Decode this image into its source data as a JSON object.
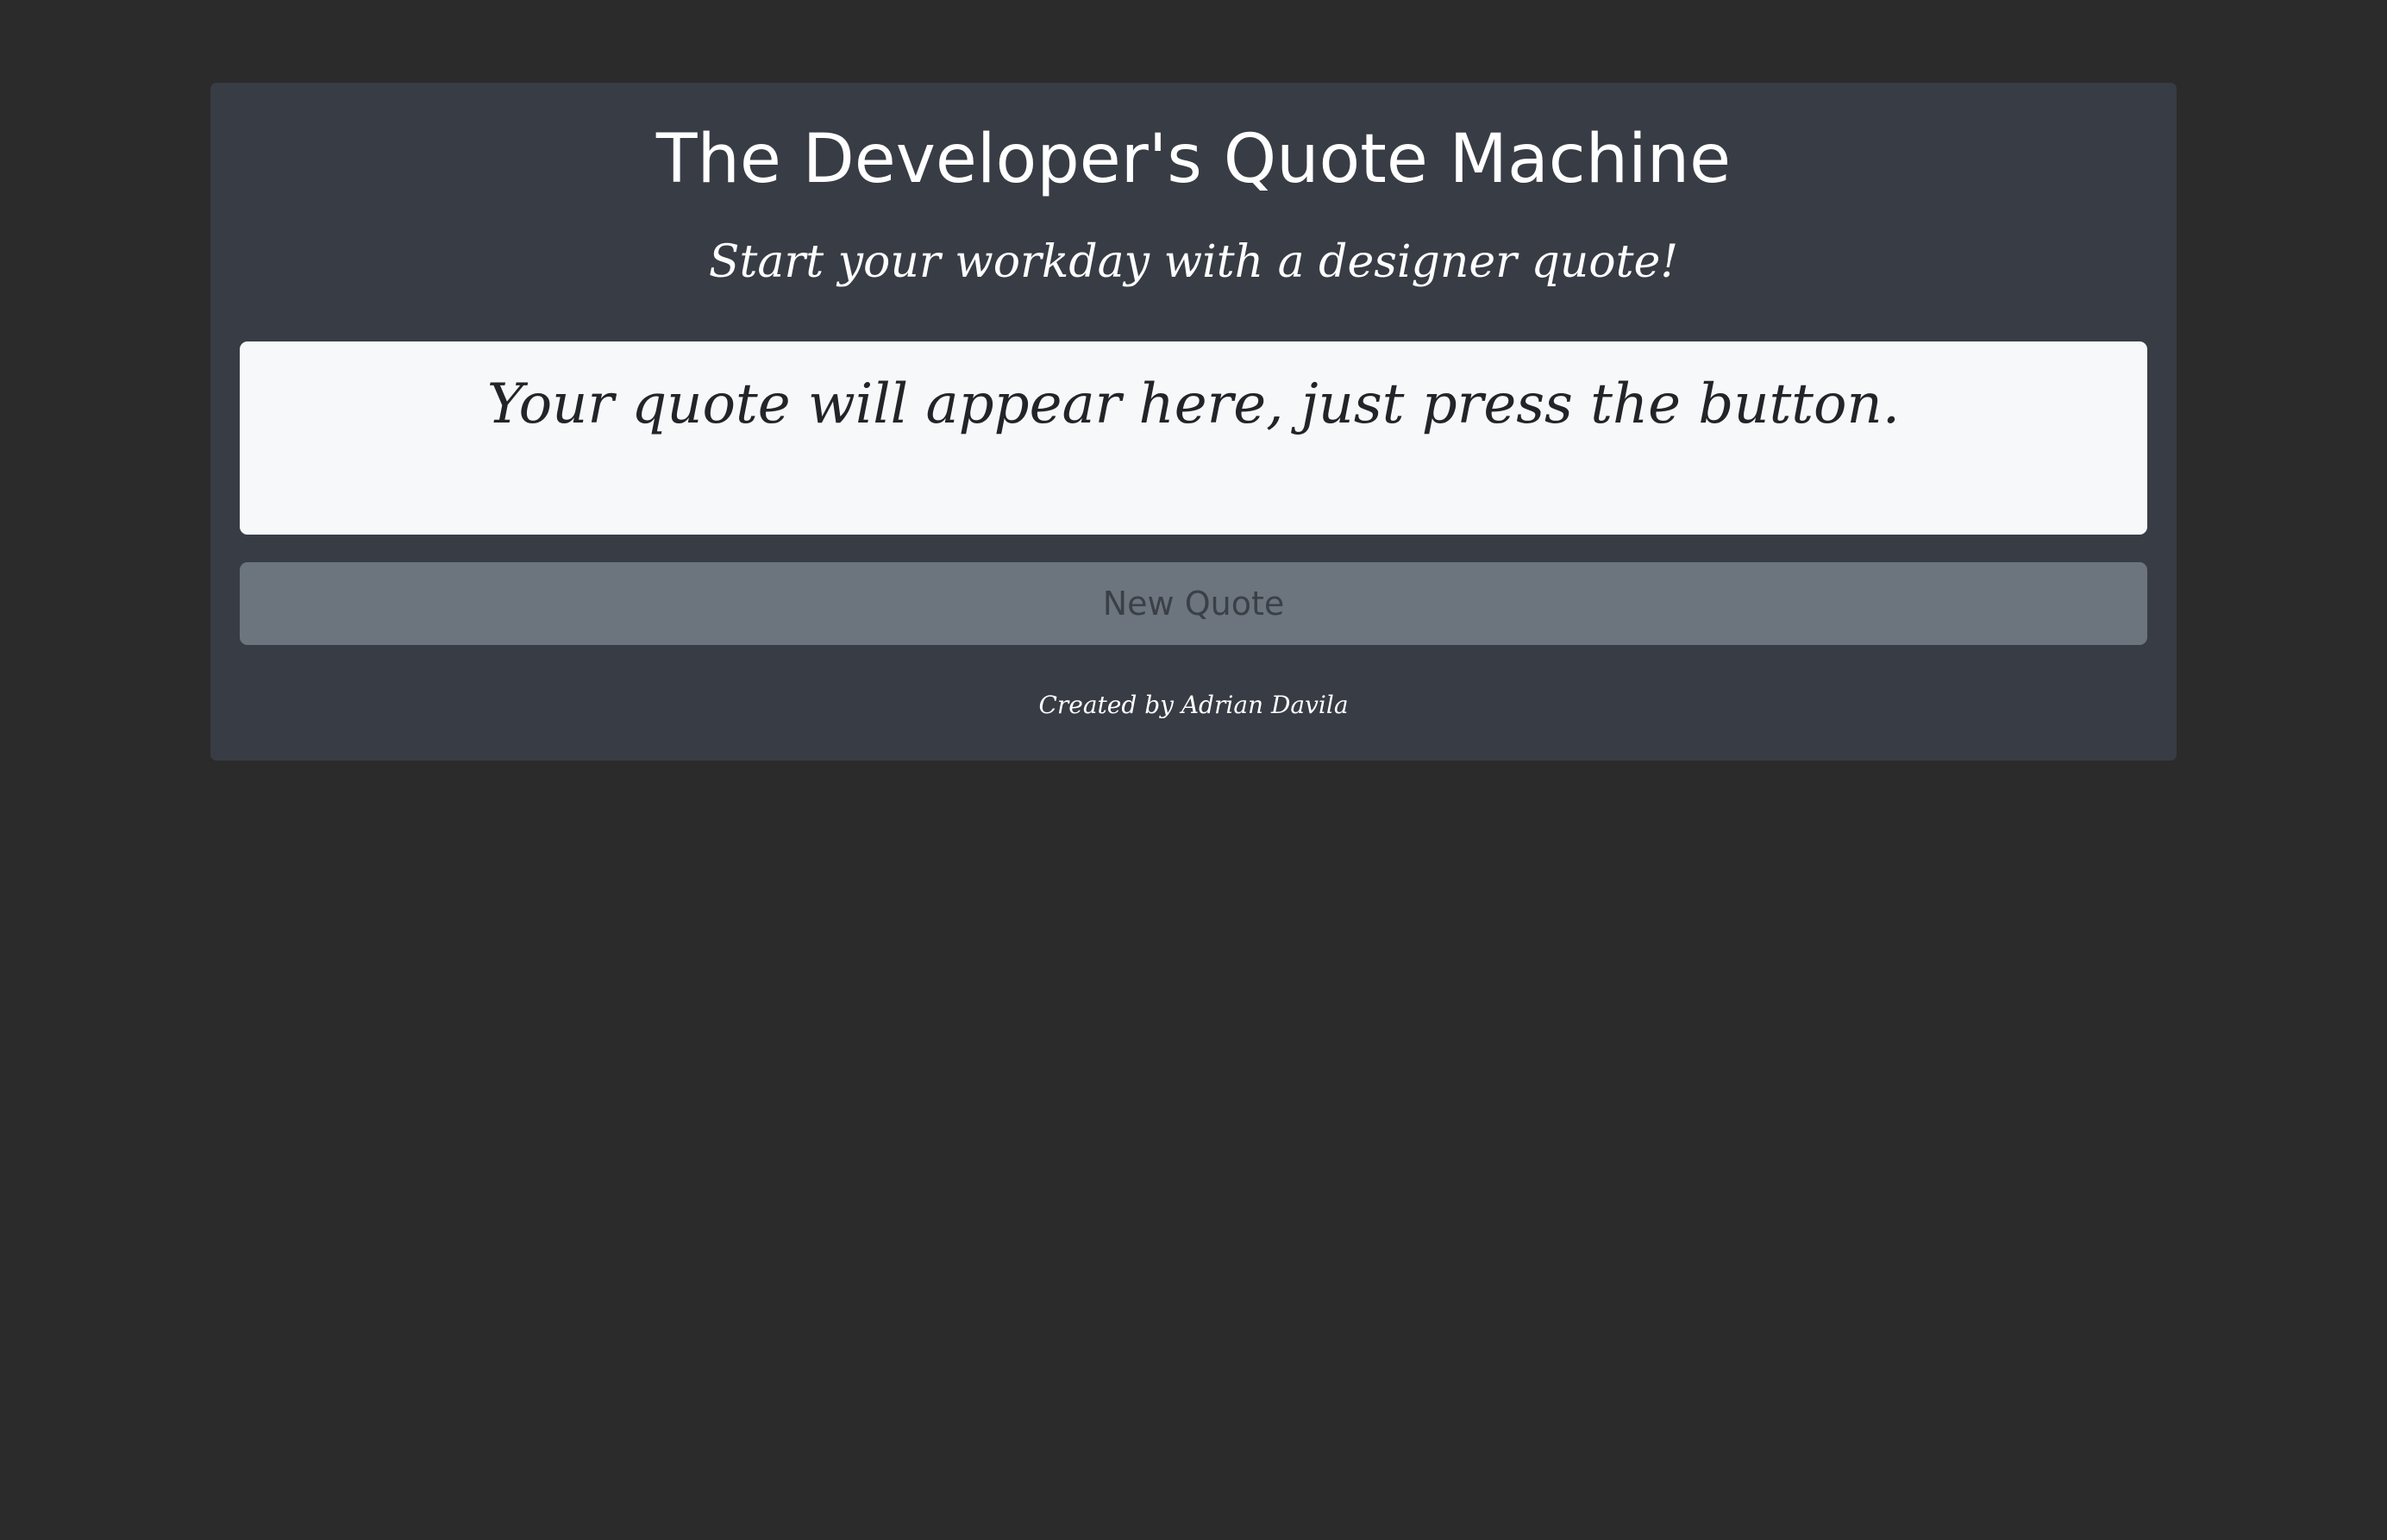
{
  "header": {
    "title": "The Developer's Quote Machine",
    "subtitle": "Start your workday with a designer quote!"
  },
  "quote": {
    "text": "Your quote will appear here, just press the button."
  },
  "actions": {
    "new_quote_label": "New Quote"
  },
  "footer": {
    "credit": "Created by Adrian Davila"
  },
  "colors": {
    "page_background": "#2b2b2b",
    "card_background": "#383c45",
    "quote_box_background": "#f7f8f9",
    "button_background": "#6c757d",
    "button_text": "#3b4047",
    "text_light": "#ffffff",
    "text_dark": "#212529"
  }
}
